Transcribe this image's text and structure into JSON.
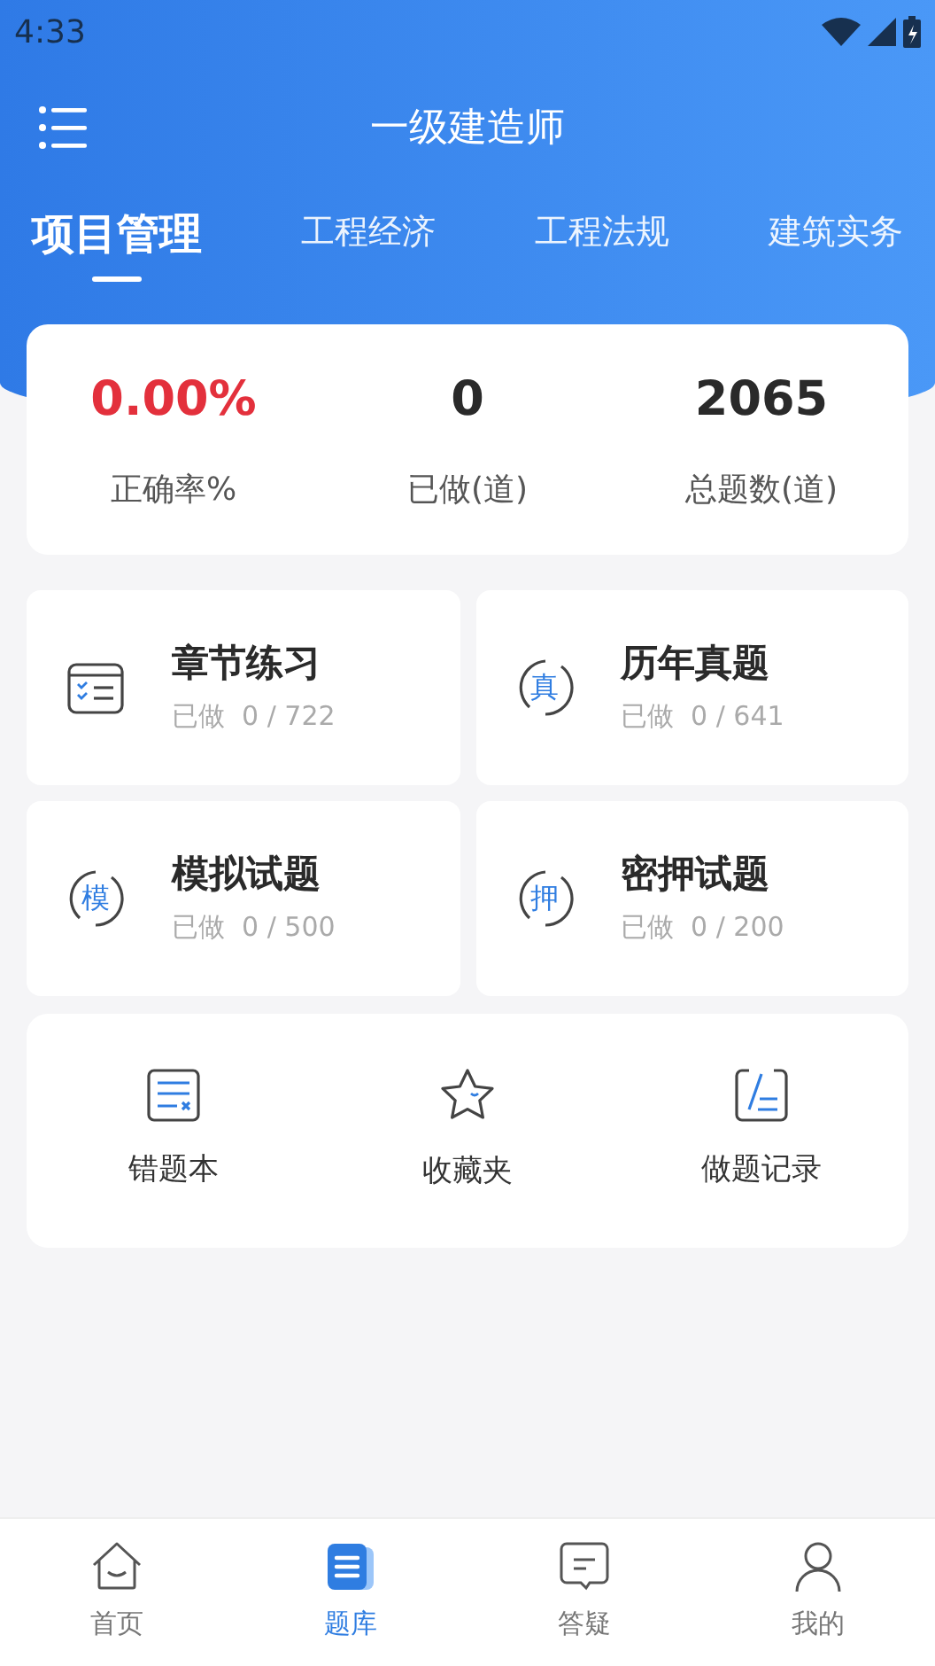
{
  "status_bar": {
    "time": "4:33"
  },
  "header": {
    "title": "一级建造师"
  },
  "tabs": [
    {
      "label": "项目管理",
      "selected": true
    },
    {
      "label": "工程经济",
      "selected": false
    },
    {
      "label": "工程法规",
      "selected": false
    },
    {
      "label": "建筑实务",
      "selected": false
    }
  ],
  "stats": [
    {
      "value": "0.00%",
      "label": "正确率%",
      "kind": "highlight"
    },
    {
      "value": "0",
      "label": "已做(道)",
      "kind": "plain"
    },
    {
      "value": "2065",
      "label": "总题数(道)",
      "kind": "plain"
    }
  ],
  "practice": [
    {
      "title": "章节练习",
      "done_label": "已做",
      "progress": "0 / 722",
      "kind": "checklist"
    },
    {
      "title": "历年真题",
      "done_label": "已做",
      "progress": "0 / 641",
      "kind": "char",
      "icon_text": "真"
    },
    {
      "title": "模拟试题",
      "done_label": "已做",
      "progress": "0 / 500",
      "kind": "char",
      "icon_text": "模"
    },
    {
      "title": "密押试题",
      "done_label": "已做",
      "progress": "0 / 200",
      "kind": "char",
      "icon_text": "押"
    }
  ],
  "tools": [
    {
      "label": "错题本",
      "kind": "wrong"
    },
    {
      "label": "收藏夹",
      "kind": "star"
    },
    {
      "label": "做题记录",
      "kind": "record"
    }
  ],
  "bottom_nav": [
    {
      "label": "首页",
      "kind": "home",
      "selected": false
    },
    {
      "label": "题库",
      "kind": "bank",
      "selected": true
    },
    {
      "label": "答疑",
      "kind": "chat",
      "selected": false
    },
    {
      "label": "我的",
      "kind": "user",
      "selected": false
    }
  ]
}
